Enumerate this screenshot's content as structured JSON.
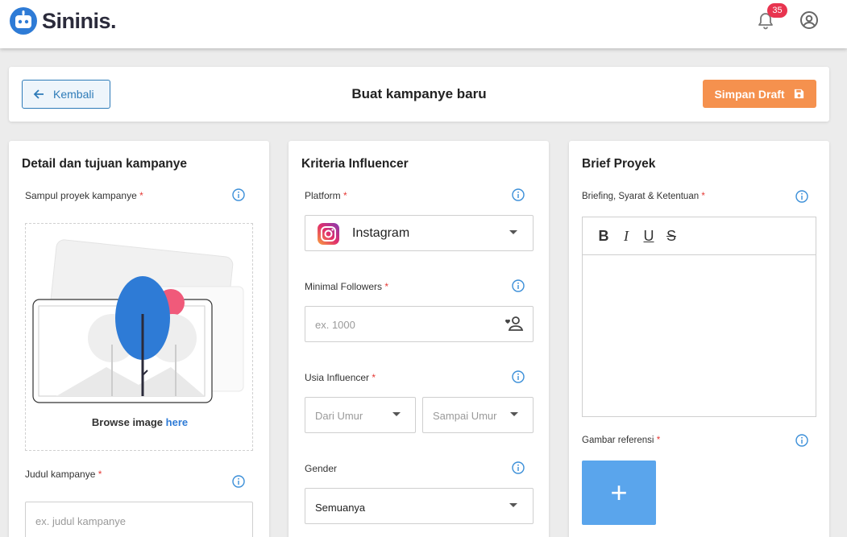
{
  "brand": {
    "name": "Sininis."
  },
  "topbar": {
    "notification_count": "35"
  },
  "header": {
    "back_label": "Kembali",
    "title": "Buat kampanye baru",
    "draft_label": "Simpan Draft"
  },
  "detail": {
    "title": "Detail dan tujuan kampanye",
    "cover_label": "Sampul proyek kampanye",
    "browse_text": "Browse image",
    "browse_link": "here",
    "campaign_title_label": "Judul kampanye",
    "campaign_title_placeholder": "ex. judul kampanye"
  },
  "criteria": {
    "title": "Kriteria Influencer",
    "platform_label": "Platform",
    "platform_value": "Instagram",
    "followers_label": "Minimal Followers",
    "followers_placeholder": "ex. 1000",
    "age_label": "Usia Influencer",
    "age_from_placeholder": "Dari Umur",
    "age_to_placeholder": "Sampai Umur",
    "gender_label": "Gender",
    "gender_value": "Semuanya"
  },
  "brief": {
    "title": "Brief Proyek",
    "briefing_label": "Briefing, Syarat & Ketentuan",
    "toolbar": [
      "B",
      "I",
      "U",
      "S"
    ],
    "reference_label": "Gambar referensi",
    "add_symbol": "+"
  },
  "required_mark": "*",
  "colors": {
    "accent_blue": "#2e7bb8",
    "draft_orange": "#f5914e",
    "badge_red": "#e8344f",
    "add_button_blue": "#5aa5ec"
  }
}
